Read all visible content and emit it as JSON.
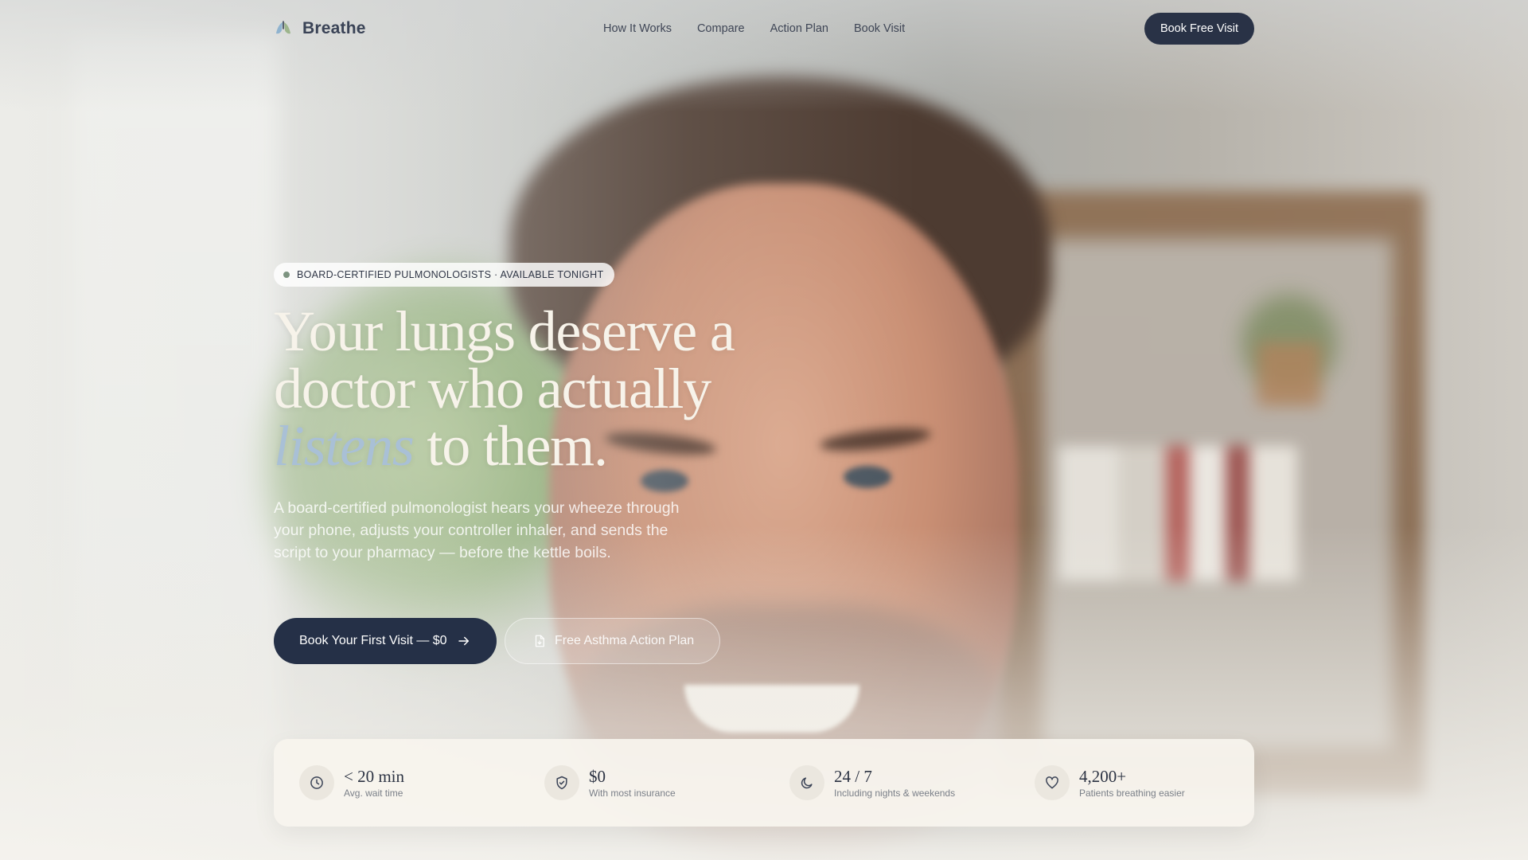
{
  "nav": {
    "brand": "Breathe",
    "links": [
      "How It Works",
      "Compare",
      "Action Plan",
      "Book Visit"
    ],
    "cta": "Book Free Visit"
  },
  "hero": {
    "badge": "BOARD-CERTIFIED PULMONOLOGISTS · AVAILABLE TONIGHT",
    "headline_part1": "Your lungs deserve a doctor who actually",
    "headline_accent": "listens",
    "headline_part2": "to them.",
    "subtext": "A board-certified pulmonologist hears your wheeze through your phone, adjusts your controller inhaler, and sends the script to your pharmacy — before the kettle boils.",
    "primary_cta": "Book Your First Visit — $0",
    "secondary_cta": "Free Asthma Action Plan"
  },
  "stats": [
    {
      "icon": "clock-icon",
      "value": "< 20 min",
      "label": "Avg. wait time"
    },
    {
      "icon": "shield-check-icon",
      "value": "$0",
      "label": "With most insurance"
    },
    {
      "icon": "moon-icon",
      "value": "24 / 7",
      "label": "Including nights & weekends"
    },
    {
      "icon": "heart-icon",
      "value": "4,200+",
      "label": "Patients breathing easier"
    }
  ],
  "colors": {
    "navy": "#253047",
    "accent_blue": "#a9c0d6",
    "card_bg": "#f7f4ee"
  }
}
